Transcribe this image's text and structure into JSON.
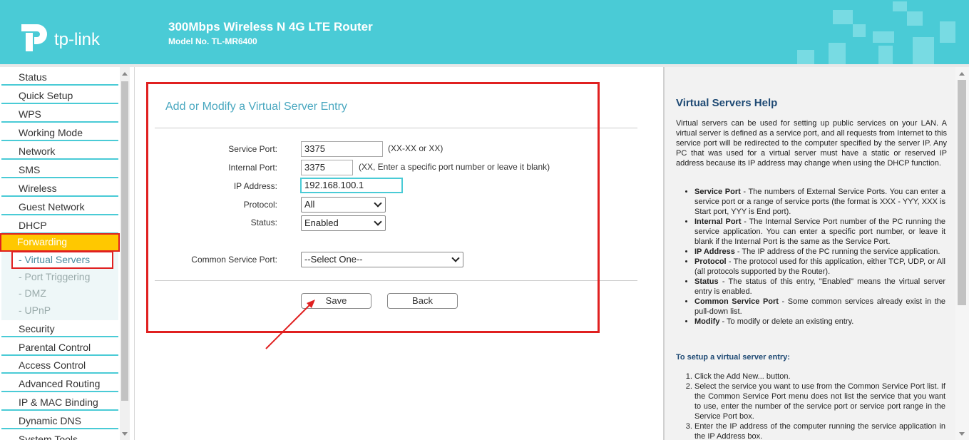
{
  "header": {
    "logo_text": "tp-link",
    "title": "300Mbps Wireless N 4G LTE Router",
    "model": "Model No. TL-MR6400"
  },
  "sidebar": {
    "items": [
      {
        "label": "Status"
      },
      {
        "label": "Quick Setup"
      },
      {
        "label": "WPS"
      },
      {
        "label": "Working Mode"
      },
      {
        "label": "Network"
      },
      {
        "label": "SMS"
      },
      {
        "label": "Wireless"
      },
      {
        "label": "Guest Network"
      },
      {
        "label": "DHCP"
      },
      {
        "label": "Forwarding"
      },
      {
        "label": "Security"
      },
      {
        "label": "Parental Control"
      },
      {
        "label": "Access Control"
      },
      {
        "label": "Advanced Routing"
      },
      {
        "label": "IP & MAC Binding"
      },
      {
        "label": "Dynamic DNS"
      },
      {
        "label": "System Tools"
      }
    ],
    "sub_items": [
      {
        "label": "- Virtual Servers"
      },
      {
        "label": "- Port Triggering"
      },
      {
        "label": "- DMZ"
      },
      {
        "label": "- UPnP"
      }
    ]
  },
  "form": {
    "title": "Add or Modify a Virtual Server Entry",
    "service_port_label": "Service Port:",
    "service_port_value": "3375",
    "service_port_hint": "(XX-XX or XX)",
    "internal_port_label": "Internal Port:",
    "internal_port_value": "3375",
    "internal_port_hint": "(XX, Enter a specific port number or leave it blank)",
    "ip_label": "IP Address:",
    "ip_value": "192.168.100.1",
    "protocol_label": "Protocol:",
    "protocol_value": "All",
    "status_label": "Status:",
    "status_value": "Enabled",
    "common_label": "Common Service Port:",
    "common_value": "--Select One--",
    "save_label": "Save",
    "back_label": "Back"
  },
  "help": {
    "title": "Virtual Servers Help",
    "intro": "Virtual servers can be used for setting up public services on your LAN. A virtual server is defined as a service port, and all requests from Internet to this service port will be redirected to the computer specified by the server IP. Any PC that was used for a virtual server must have a static or reserved IP address because its IP address may change when using the DHCP function.",
    "bullets": [
      {
        "term": "Service Port",
        "text": " - The numbers of External Service Ports. You can enter a service port or a range of service ports (the format is XXX - YYY, XXX is Start port, YYY is End port)."
      },
      {
        "term": "Internal Port",
        "text": " - The Internal Service Port number of the PC running the service application. You can enter a specific port number, or leave it blank if the Internal Port is the same as the Service Port."
      },
      {
        "term": "IP Address",
        "text": " - The IP address of the PC running the service application."
      },
      {
        "term": "Protocol",
        "text": " - The protocol used for this application, either TCP, UDP, or All (all protocols supported by the Router)."
      },
      {
        "term": "Status",
        "text": " - The status of this entry, \"Enabled\" means the virtual server entry is enabled."
      },
      {
        "term": "Common Service Port",
        "text": " - Some common services already exist in the pull-down list."
      },
      {
        "term": "Modify",
        "text": " - To modify or delete an existing entry."
      }
    ],
    "setup_title": "To setup a virtual server entry:",
    "steps": [
      "Click the Add New... button.",
      "Select the service you want to use from the Common Service Port list. If the Common Service Port menu does not list the service that you want to use, enter the number of the service port or service port range in the Service Port box.",
      "Enter the IP address of the computer running the service application in the IP Address box."
    ]
  },
  "colors": {
    "brand": "#4acbd6",
    "active_menu": "#ffc800",
    "annotation": "#e02020"
  }
}
